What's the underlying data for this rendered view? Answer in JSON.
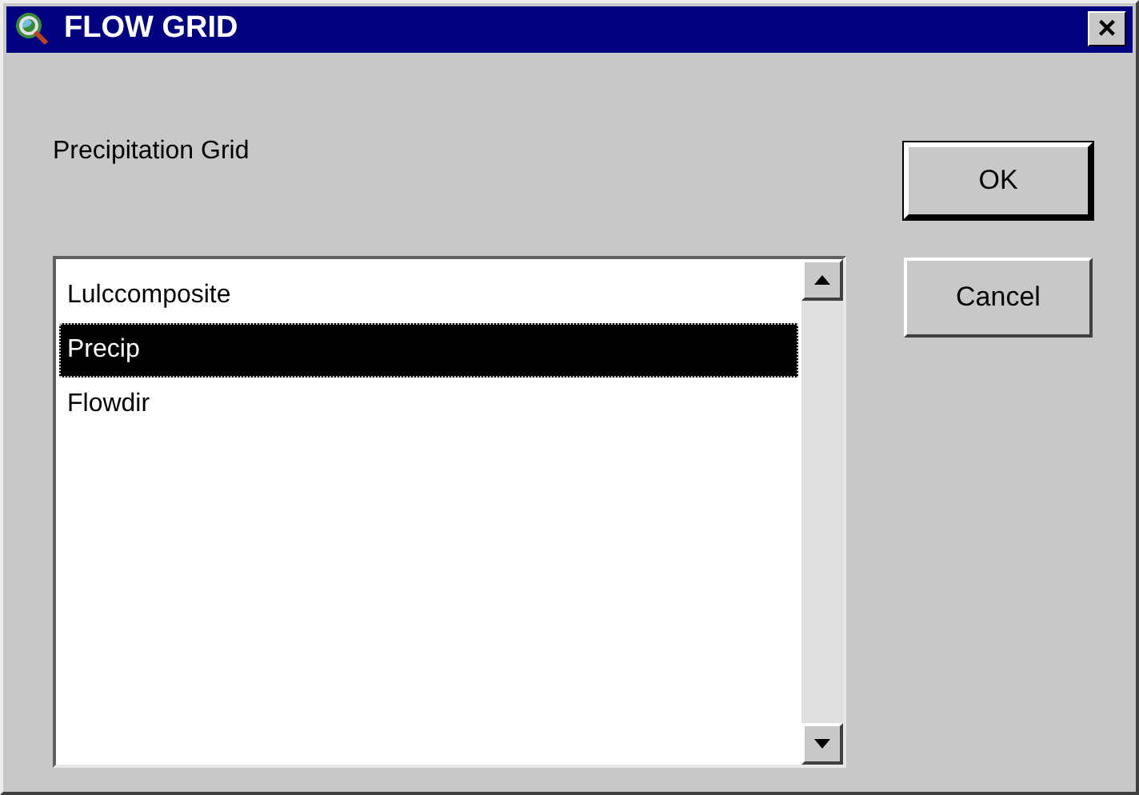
{
  "window": {
    "title": "FLOW GRID",
    "close": "×"
  },
  "label": "Precipitation Grid",
  "list": {
    "items": [
      {
        "label": "Lulccomposite",
        "selected": false
      },
      {
        "label": "Precip",
        "selected": true
      },
      {
        "label": "Flowdir",
        "selected": false
      }
    ]
  },
  "buttons": [
    {
      "label": "OK",
      "default": true
    },
    {
      "label": "Cancel",
      "default": false
    }
  ]
}
